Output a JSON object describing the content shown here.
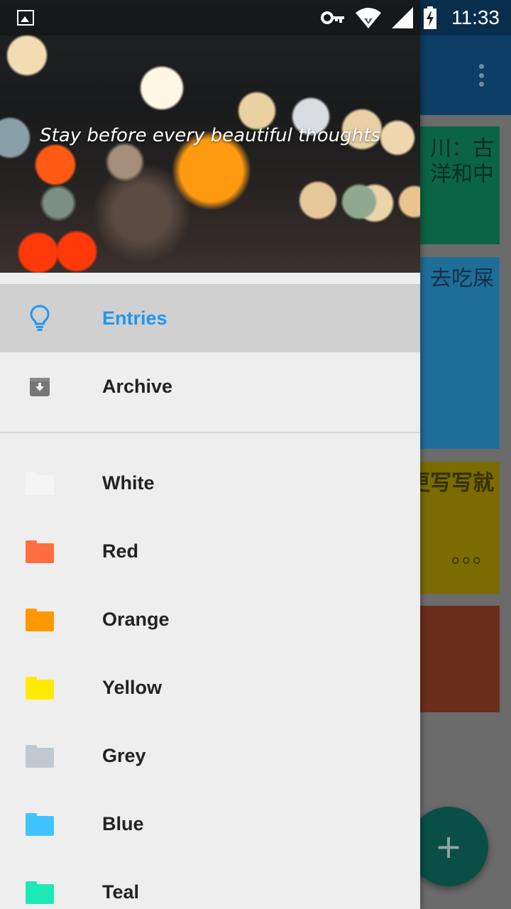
{
  "status_bar": {
    "time": "11:33",
    "icons": [
      "image-icon",
      "vpn-key-icon",
      "wifi-icon",
      "signal-icon",
      "battery-charging-icon"
    ]
  },
  "background_app": {
    "notes": [
      {
        "text": "川：古\n洋和中",
        "color": "#0b6445"
      },
      {
        "text": "去吃屎",
        "color": "#1f6e99"
      },
      {
        "text": "更写写就\n\n\n\n\n\n。。。",
        "color": "#7a6c00"
      },
      {
        "text": "",
        "color": "#6b2d1c"
      }
    ],
    "fab_label": "+"
  },
  "drawer": {
    "header_quote": "Stay before every beautiful thoughts",
    "primary_items": [
      {
        "label": "Entries",
        "icon": "lightbulb-icon",
        "active": true
      },
      {
        "label": "Archive",
        "icon": "archive-icon",
        "active": false
      }
    ],
    "folders": [
      {
        "label": "White",
        "color": "#f5f5f5"
      },
      {
        "label": "Red",
        "color": "#ff6e40"
      },
      {
        "label": "Orange",
        "color": "#ff9800"
      },
      {
        "label": "Yellow",
        "color": "#ffeb00"
      },
      {
        "label": "Grey",
        "color": "#c0c9cf"
      },
      {
        "label": "Blue",
        "color": "#40c4ff"
      },
      {
        "label": "Teal",
        "color": "#1de9b6"
      }
    ],
    "accent_color": "#2196f3"
  }
}
